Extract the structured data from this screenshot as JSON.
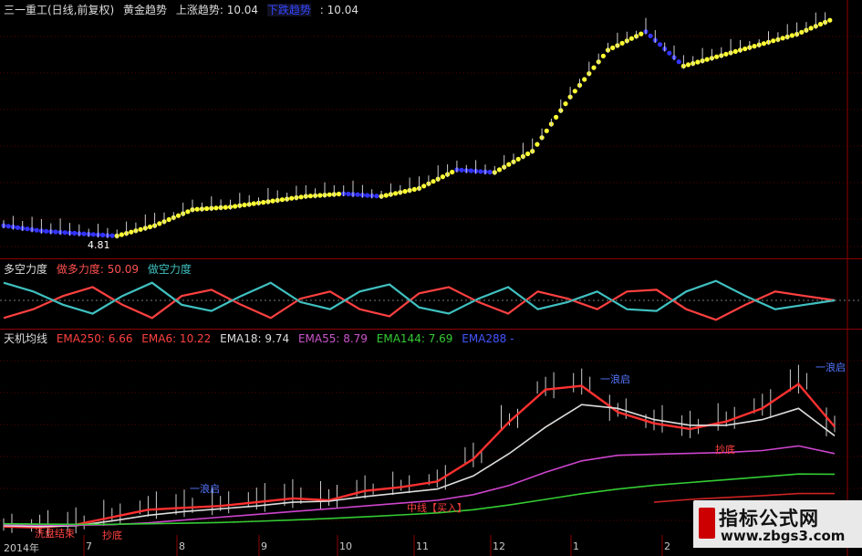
{
  "header_main": {
    "name": "三一重工(日线,前复权)",
    "indicator": "黄金趋势",
    "up_label": "上涨趋势: 10.04",
    "down_label": "下跌趋势",
    "down_value": ": 10.04"
  },
  "header_mid": {
    "name": "多空力度",
    "long_label": "做多力度: 50.09",
    "short_label": "做空力度"
  },
  "header_low": {
    "name": "天机均线",
    "ema250": "EMA250: 6.66",
    "ema6": "EMA6: 10.22",
    "ema18": "EMA18: 9.74",
    "ema55": "EMA55: 8.79",
    "ema144": "EMA144: 7.69",
    "ema288": "EMA288 -"
  },
  "annotations": {
    "price_low": "4.81",
    "a1": "一浪启",
    "a2": "一浪启",
    "a3": "一浪启",
    "a4": "抄底",
    "a5": "抄底",
    "a6": "洗盘结束",
    "a7": "中线【买入】"
  },
  "x_axis": [
    "2014年",
    "7",
    "8",
    "9",
    "10",
    "11",
    "12",
    "1",
    "2"
  ],
  "logo": {
    "line1": "指标公式网",
    "line2": "www.zbgs3.com"
  },
  "colors": {
    "up_trend": "#ffff33",
    "down_trend": "#3333ff",
    "long": "#ff4040",
    "short": "#40c0c0",
    "ema6": "#ff3030",
    "ema18": "#dddddd",
    "ema55": "#cc44cc",
    "ema144": "#33cc33",
    "ema250": "#cc2222",
    "ema288": "#4444ff",
    "candle": "#cccccc"
  },
  "chart_data": [
    {
      "type": "line",
      "x_labels": [
        "2014年",
        "7",
        "8",
        "9",
        "10",
        "11",
        "12",
        "1",
        "2"
      ],
      "series": [
        {
          "name": "黄金趋势",
          "values": [
            5.2,
            5.0,
            4.9,
            4.81,
            5.2,
            5.8,
            5.9,
            6.1,
            6.3,
            6.4,
            6.3,
            6.6,
            7.3,
            7.2,
            8.0,
            10.04,
            11.8,
            12.5,
            11.2,
            11.6,
            12.0,
            12.4,
            13.0
          ]
        }
      ]
    },
    {
      "type": "line",
      "series": [
        {
          "name": "做多力度",
          "values": [
            30,
            40,
            55,
            65,
            45,
            30,
            55,
            62,
            45,
            30,
            52,
            60,
            40,
            32,
            58,
            65,
            48,
            35,
            60,
            52,
            40,
            60,
            62,
            40,
            28,
            45,
            60,
            55,
            50.09
          ]
        },
        {
          "name": "做空力度",
          "values": [
            70,
            60,
            45,
            35,
            55,
            70,
            45,
            38,
            55,
            70,
            48,
            40,
            60,
            68,
            42,
            35,
            52,
            65,
            40,
            48,
            60,
            40,
            38,
            60,
            72,
            55,
            40,
            45,
            50
          ]
        }
      ]
    },
    {
      "type": "line",
      "series": [
        {
          "name": "EMA6",
          "values": [
            4.9,
            4.85,
            5.0,
            5.4,
            5.8,
            5.9,
            6.0,
            6.2,
            6.4,
            6.3,
            6.8,
            7.0,
            7.3,
            8.5,
            10.5,
            12.2,
            12.4,
            11.0,
            10.4,
            10.1,
            10.5,
            11.2,
            12.5,
            10.22
          ]
        },
        {
          "name": "EMA18",
          "values": [
            4.95,
            4.9,
            4.95,
            5.2,
            5.5,
            5.7,
            5.85,
            6.0,
            6.2,
            6.25,
            6.5,
            6.7,
            6.9,
            7.6,
            8.8,
            10.2,
            11.4,
            11.2,
            10.6,
            10.3,
            10.3,
            10.6,
            11.2,
            9.74
          ]
        },
        {
          "name": "EMA55",
          "values": [
            5.0,
            4.98,
            4.97,
            5.0,
            5.1,
            5.25,
            5.4,
            5.55,
            5.7,
            5.85,
            6.0,
            6.15,
            6.3,
            6.6,
            7.1,
            7.8,
            8.4,
            8.7,
            8.75,
            8.8,
            8.85,
            8.95,
            9.2,
            8.79
          ]
        },
        {
          "name": "EMA144",
          "values": [
            5.05,
            5.03,
            5.02,
            5.02,
            5.05,
            5.08,
            5.12,
            5.18,
            5.25,
            5.33,
            5.42,
            5.52,
            5.63,
            5.8,
            6.05,
            6.35,
            6.65,
            6.9,
            7.1,
            7.25,
            7.4,
            7.55,
            7.7,
            7.69
          ]
        },
        {
          "name": "EMA250",
          "values": [
            null,
            null,
            null,
            null,
            null,
            null,
            null,
            null,
            null,
            null,
            null,
            null,
            null,
            null,
            null,
            null,
            null,
            null,
            6.2,
            6.35,
            6.45,
            6.55,
            6.66,
            6.66
          ]
        }
      ]
    }
  ]
}
